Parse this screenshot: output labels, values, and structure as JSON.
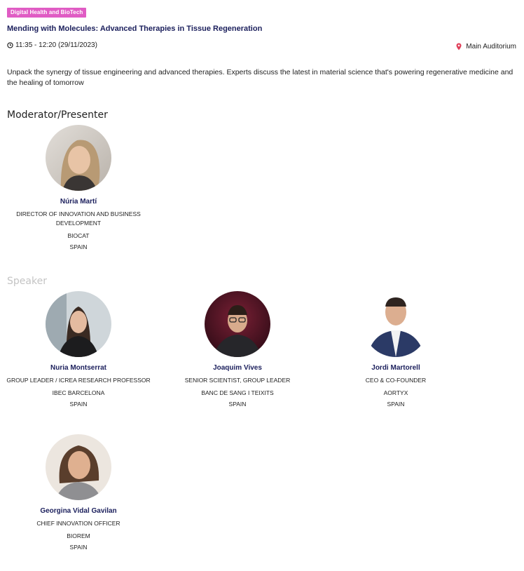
{
  "session": {
    "tag": "Digital Health and BioTech",
    "title": "Mending with Molecules: Advanced Therapies in Tissue Regeneration",
    "time": "11:35 - 12:20 (29/11/2023)",
    "location": "Main Auditorium",
    "description": "Unpack the synergy of tissue engineering and advanced therapies. Experts discuss the latest in material science that's powering regenerative medicine and the healing of tomorrow"
  },
  "icons": {
    "clock": "clock-icon",
    "pin": "map-pin-icon"
  },
  "colors": {
    "tag_bg": "#e05cc4",
    "name": "#1b1f5c",
    "pin": "#e0405a"
  },
  "moderators": {
    "heading": "Moderator/Presenter",
    "people": [
      {
        "name": "Núria Martí",
        "role": "DIRECTOR OF INNOVATION AND BUSINESS DEVELOPMENT",
        "org": "BIOCAT",
        "country": "SPAIN"
      }
    ]
  },
  "speakers": {
    "heading": "Speaker",
    "people": [
      {
        "name": "Nuria Montserrat",
        "role": "GROUP LEADER / ICREA RESEARCH PROFESSOR",
        "org": "IBEC BARCELONA",
        "country": "SPAIN"
      },
      {
        "name": "Joaquim Vives",
        "role": "SENIOR SCIENTIST, GROUP LEADER",
        "org": "BANC DE SANG I TEIXITS",
        "country": "SPAIN"
      },
      {
        "name": "Jordi Martorell",
        "role": "CEO & CO-FOUNDER",
        "org": "AORTYX",
        "country": "SPAIN"
      },
      {
        "name": "Georgina Vidal Gavilan",
        "role": "CHIEF INNOVATION OFFICER",
        "org": "BIOREM",
        "country": "SPAIN"
      }
    ]
  }
}
